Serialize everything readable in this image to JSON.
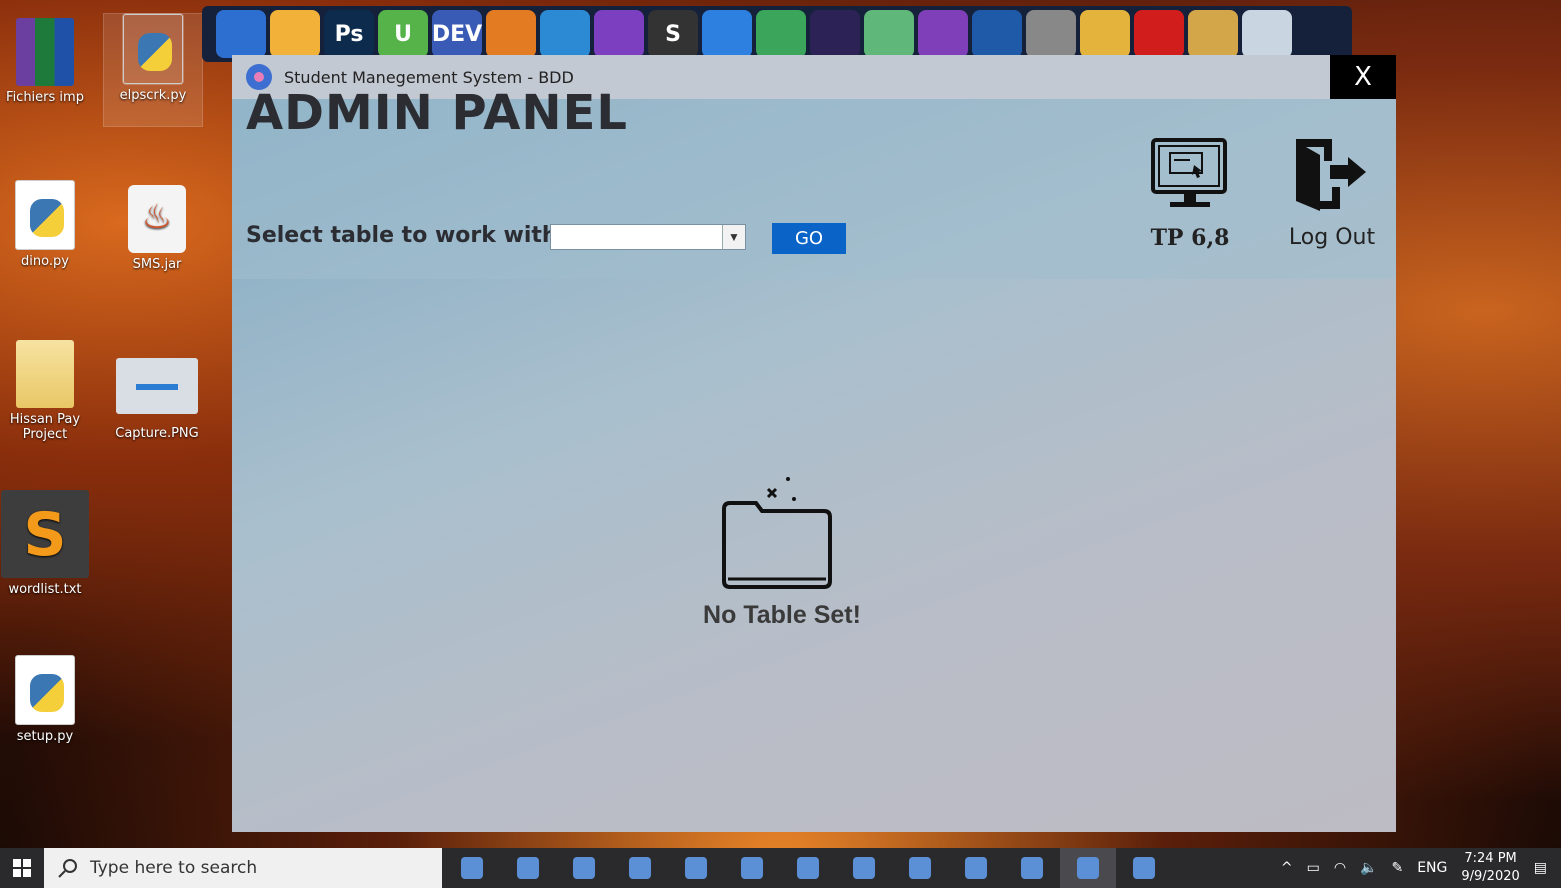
{
  "desktop": {
    "icons": [
      {
        "label": "Fichiers imp"
      },
      {
        "label": "elpscrk.py"
      },
      {
        "label": "dino.py"
      },
      {
        "label": "SMS.jar"
      },
      {
        "label": "Hissan Pay Project"
      },
      {
        "label": "Capture.PNG"
      },
      {
        "label": "wordlist.txt"
      },
      {
        "label": "setup.py"
      }
    ]
  },
  "dock": {
    "items": [
      {
        "icon": "downloads-icon",
        "color": "#2d6fd1",
        "text": ""
      },
      {
        "icon": "folder-icon",
        "color": "#f2b23a",
        "text": ""
      },
      {
        "icon": "photoshop-icon",
        "color": "#0c2b4d",
        "text": "Ps"
      },
      {
        "icon": "utorrent-icon",
        "color": "#55b34a",
        "text": "U"
      },
      {
        "icon": "devcpp-icon",
        "color": "#3a5bb5",
        "text": "DEV"
      },
      {
        "icon": "blender-icon",
        "color": "#e27b22",
        "text": ""
      },
      {
        "icon": "vscode-icon",
        "color": "#2c8ad4",
        "text": ""
      },
      {
        "icon": "visual-studio-icon",
        "color": "#7b3fbf",
        "text": ""
      },
      {
        "icon": "sublime-icon",
        "color": "#333",
        "text": "S"
      },
      {
        "icon": "lightning-icon",
        "color": "#2d7fe0",
        "text": ""
      },
      {
        "icon": "android-studio-icon",
        "color": "#3ba55c",
        "text": ""
      },
      {
        "icon": "eclipse-icon",
        "color": "#2c2255",
        "text": ""
      },
      {
        "icon": "atom-icon",
        "color": "#5fb87a",
        "text": ""
      },
      {
        "icon": "tor-icon",
        "color": "#7e3fb8",
        "text": ""
      },
      {
        "icon": "virtualbox-icon",
        "color": "#1f5aa8",
        "text": ""
      },
      {
        "icon": "tools-icon",
        "color": "#888",
        "text": ""
      },
      {
        "icon": "chrome-icon",
        "color": "#e3b33c",
        "text": ""
      },
      {
        "icon": "opera-icon",
        "color": "#d21d1d",
        "text": ""
      },
      {
        "icon": "wrench-icon",
        "color": "#d4a64a",
        "text": ""
      },
      {
        "icon": "recycle-bin-icon",
        "color": "#c9d6e2",
        "text": ""
      }
    ]
  },
  "window": {
    "title": "Student Manegement System - BDD",
    "close_label": "X",
    "heading": "ADMIN PANEL",
    "select_label": "Select table to work with :",
    "select_value": "",
    "go_label": "GO",
    "tp_label": "TP 6,8",
    "logout_label": "Log Out",
    "empty_message": "No Table Set!"
  },
  "taskbar": {
    "search_placeholder": "Type here to search",
    "apps": [
      {
        "icon": "task-view-icon"
      },
      {
        "icon": "edge-icon"
      },
      {
        "icon": "terminal-icon"
      },
      {
        "icon": "file-explorer-icon"
      },
      {
        "icon": "word-icon"
      },
      {
        "icon": "store-icon"
      },
      {
        "icon": "snipping-icon"
      },
      {
        "icon": "powershell-icon"
      },
      {
        "icon": "opera-icon"
      },
      {
        "icon": "sublime-icon"
      },
      {
        "icon": "game-icon"
      },
      {
        "icon": "student-app-icon"
      },
      {
        "icon": "photos-icon"
      }
    ],
    "language": "ENG",
    "time": "7:24 PM",
    "date": "9/9/2020"
  }
}
